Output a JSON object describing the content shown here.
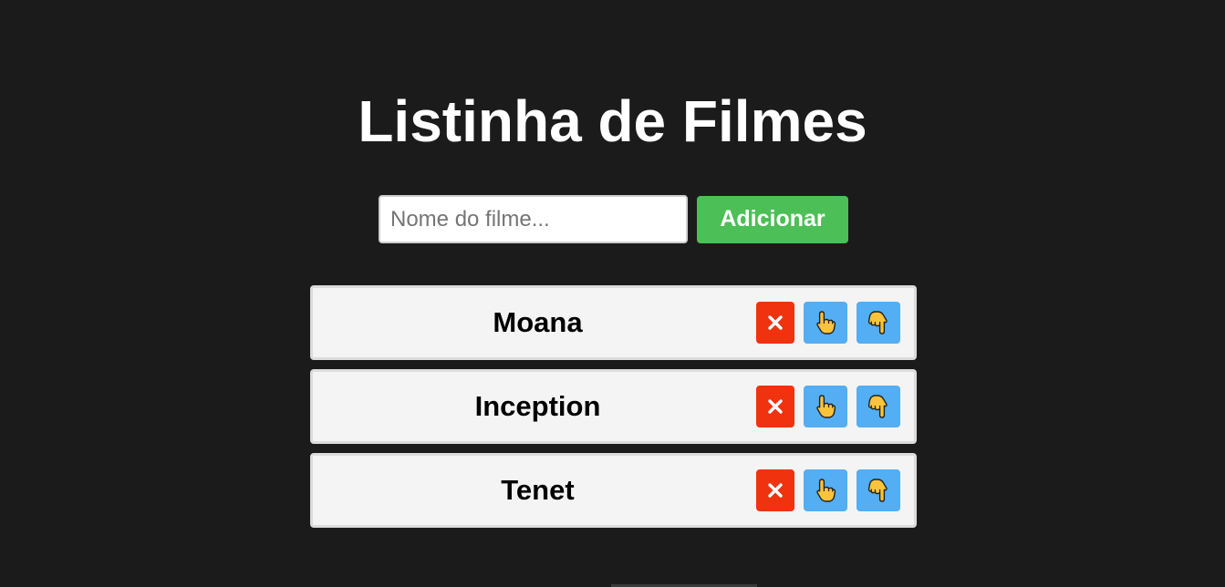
{
  "page": {
    "title": "Listinha de Filmes"
  },
  "form": {
    "input_placeholder": "Nome do filme...",
    "input_value": "",
    "add_label": "Adicionar"
  },
  "movies": [
    {
      "name": "Moana"
    },
    {
      "name": "Inception"
    },
    {
      "name": "Tenet"
    }
  ],
  "icons": {
    "remove": "close-icon",
    "like": "hand-pointing-up-icon",
    "dislike": "hand-pointing-down-icon"
  },
  "colors": {
    "background": "#1b1b1b",
    "add_button": "#4cbf56",
    "remove_button": "#f0320f",
    "vote_button": "#53aef3",
    "item_background": "#f4f4f4"
  }
}
